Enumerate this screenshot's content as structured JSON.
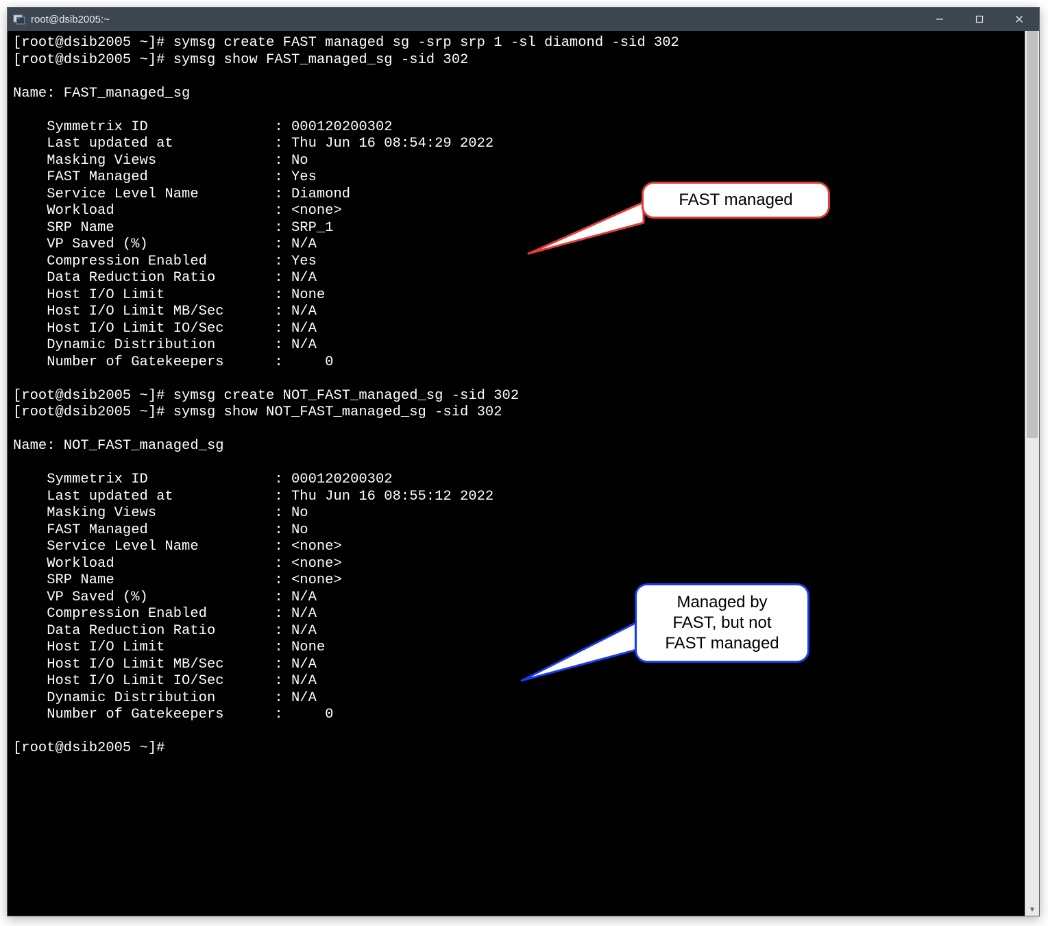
{
  "window": {
    "title": "root@dsib2005:~"
  },
  "prompt": "[root@dsib2005 ~]#",
  "commands": {
    "c1": "symsg create FAST managed sg -srp srp 1 -sl diamond -sid 302",
    "c2": "symsg show FAST_managed_sg -sid 302",
    "c3": "symsg create NOT_FAST_managed_sg -sid 302",
    "c4": "symsg show NOT_FAST_managed_sg -sid 302"
  },
  "sg1": {
    "name_line": "Name: FAST_managed_sg",
    "fields": [
      {
        "k": "Symmetrix ID",
        "v": "000120200302"
      },
      {
        "k": "Last updated at",
        "v": "Thu Jun 16 08:54:29 2022"
      },
      {
        "k": "Masking Views",
        "v": "No"
      },
      {
        "k": "FAST Managed",
        "v": "Yes"
      },
      {
        "k": "Service Level Name",
        "v": "Diamond"
      },
      {
        "k": "Workload",
        "v": "<none>"
      },
      {
        "k": "SRP Name",
        "v": "SRP_1"
      },
      {
        "k": "VP Saved (%)",
        "v": "N/A"
      },
      {
        "k": "Compression Enabled",
        "v": "Yes"
      },
      {
        "k": "Data Reduction Ratio",
        "v": "N/A"
      },
      {
        "k": "Host I/O Limit",
        "v": "None"
      },
      {
        "k": "Host I/O Limit MB/Sec",
        "v": "N/A"
      },
      {
        "k": "Host I/O Limit IO/Sec",
        "v": "N/A"
      },
      {
        "k": "Dynamic Distribution",
        "v": "N/A"
      },
      {
        "k": "Number of Gatekeepers",
        "v": "    0"
      }
    ]
  },
  "sg2": {
    "name_line": "Name: NOT_FAST_managed_sg",
    "fields": [
      {
        "k": "Symmetrix ID",
        "v": "000120200302"
      },
      {
        "k": "Last updated at",
        "v": "Thu Jun 16 08:55:12 2022"
      },
      {
        "k": "Masking Views",
        "v": "No"
      },
      {
        "k": "FAST Managed",
        "v": "No"
      },
      {
        "k": "Service Level Name",
        "v": "<none>"
      },
      {
        "k": "Workload",
        "v": "<none>"
      },
      {
        "k": "SRP Name",
        "v": "<none>"
      },
      {
        "k": "VP Saved (%)",
        "v": "N/A"
      },
      {
        "k": "Compression Enabled",
        "v": "N/A"
      },
      {
        "k": "Data Reduction Ratio",
        "v": "N/A"
      },
      {
        "k": "Host I/O Limit",
        "v": "None"
      },
      {
        "k": "Host I/O Limit MB/Sec",
        "v": "N/A"
      },
      {
        "k": "Host I/O Limit IO/Sec",
        "v": "N/A"
      },
      {
        "k": "Dynamic Distribution",
        "v": "N/A"
      },
      {
        "k": "Number of Gatekeepers",
        "v": "    0"
      }
    ]
  },
  "callouts": {
    "red": "FAST managed",
    "blue": "Managed by\nFAST, but not\nFAST managed"
  }
}
